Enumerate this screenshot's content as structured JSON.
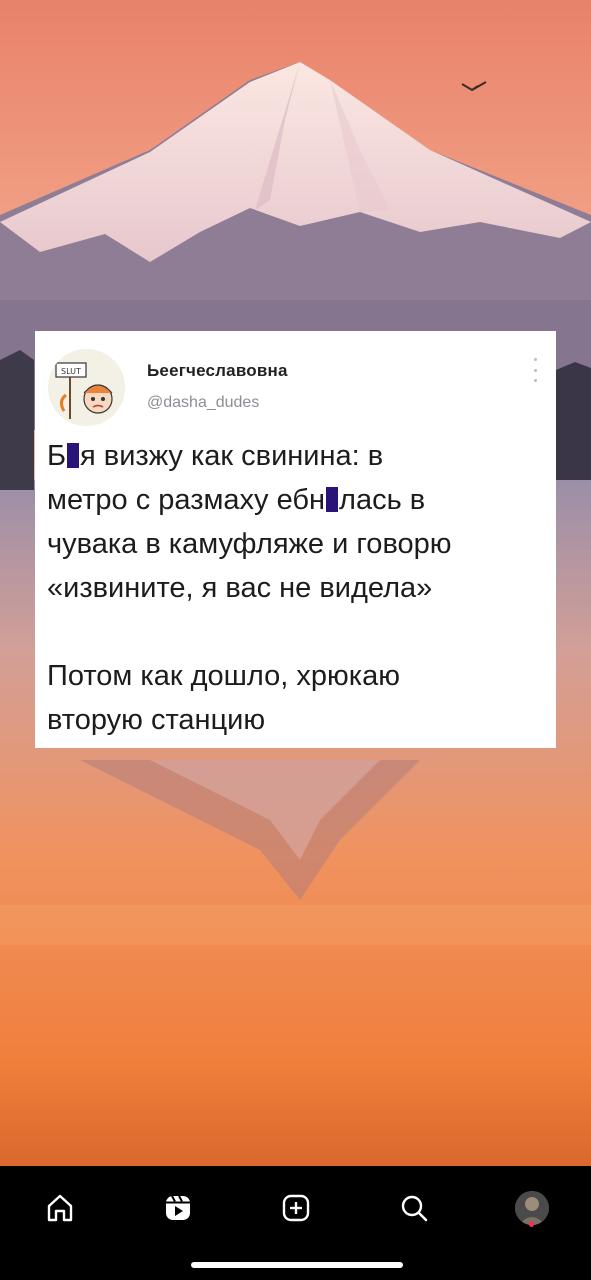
{
  "post": {
    "display_name": "Ьеегчеславовна",
    "handle": "@dasha_dudes",
    "avatar_sign": "SLUT",
    "line1_before": "Б",
    "line1_after": "я визжу как свинина: в",
    "line2_before": "метро с размаху ебн",
    "line2_after": "лась в",
    "line3": "чувака в камуфляже и говорю",
    "line4": "«извините, я вас не видела»",
    "line5": "Потом как дошло, хрюкаю",
    "line6": "вторую станцию"
  },
  "nav": {
    "items": [
      "home-icon",
      "reels-icon",
      "create-icon",
      "search-icon",
      "profile-avatar"
    ]
  }
}
